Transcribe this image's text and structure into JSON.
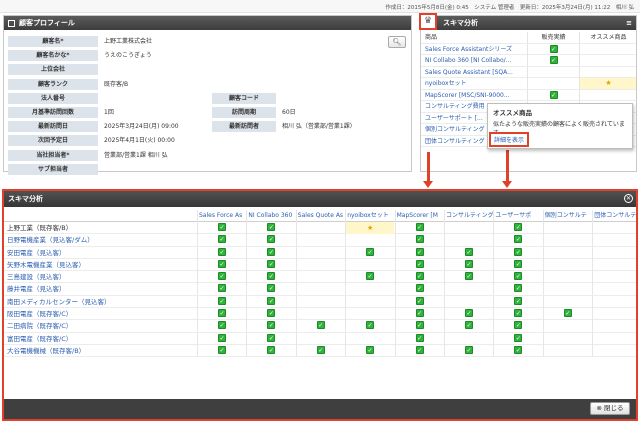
{
  "status_bar": "作成日：2015年5月8日(金) 0:45　システム 管理者　更新日：2025年3月24日(月) 11:22　相川 弘",
  "profile": {
    "title": "顧客プロフィール",
    "search_icon": "search-icon",
    "fields": [
      {
        "label": "顧客名*",
        "value": "上野工業株式会社"
      },
      {
        "label": "顧客名かな*",
        "value": "うえのこうぎょう"
      },
      {
        "label": "上位会社",
        "value": ""
      },
      {
        "label": "顧客ランク",
        "value": "既存客/B"
      },
      {
        "label": "法人番号",
        "value": ""
      },
      {
        "label": "月基準訪問回数",
        "value": "1回"
      },
      {
        "label": "最新訪問日",
        "value": "2025年3月24日(月) 09:00"
      },
      {
        "label": "次回予定日",
        "value": "2025年4月1日(火) 00:00"
      },
      {
        "label": "当社担当者*",
        "value": "営業部/営業1課 相川 弘"
      },
      {
        "label": "サブ担当者",
        "value": ""
      }
    ],
    "right_fields": [
      {
        "label": "顧客コード",
        "value": ""
      },
      {
        "label": "訪問周期",
        "value": "60日"
      },
      {
        "label": "最新訪問者",
        "value": "相川 弘（営業部/営業1課）"
      }
    ]
  },
  "skima_small": {
    "title": "スキマ分析",
    "col_name": "商品",
    "col1": "販売実績",
    "col2": "オススメ商品",
    "rows": [
      {
        "name": "Sales Force Assistantシリーズ",
        "c1": true,
        "c2": false
      },
      {
        "name": "NI Collabo 360 [NI Collabo/...",
        "c1": true,
        "c2": false
      },
      {
        "name": "Sales Quote Assistant [SQA...",
        "c1": false,
        "c2": false
      },
      {
        "name": "nyoiboxセット",
        "c1": false,
        "c2": "star"
      },
      {
        "name": "MapScorer [MSC/SNI-9000...",
        "c1": true,
        "c2": false
      },
      {
        "name": "コンサルティング費用",
        "c1": false,
        "c2": false
      },
      {
        "name": "ユーザーサポート [...",
        "c1": false,
        "c2": false
      },
      {
        "name": "個別コンサルティング",
        "c1": false,
        "c2": false
      },
      {
        "name": "団体コンサルティング [SNI-9...",
        "c1": false,
        "c2": false
      }
    ]
  },
  "tooltip": {
    "title": "オススメ商品",
    "desc": "似たような販売実績の顧客によく販売されています。",
    "link": "詳細を表示"
  },
  "big": {
    "title": "スキマ分析",
    "close_label": "閉じる",
    "columns": [
      "Sales Force As",
      "NI Collabo 360",
      "Sales Quote As",
      "nyoiboxセット",
      "MapScorer [M",
      "コンサルティング",
      "ユーザーサポ",
      "個別コンサルテ",
      "団体コンサルテ"
    ],
    "rows": [
      {
        "name": "上野工業（既存客/B）",
        "cells": [
          1,
          1,
          0,
          "star",
          1,
          0,
          1,
          0,
          0
        ]
      },
      {
        "name": "日野電機産業（見込客/ダム）",
        "cells": [
          1,
          1,
          0,
          0,
          1,
          0,
          1,
          0,
          0
        ]
      },
      {
        "name": "安田電産（見込客）",
        "cells": [
          1,
          1,
          0,
          1,
          1,
          1,
          1,
          0,
          0
        ]
      },
      {
        "name": "矢野木電機産業（見込客）",
        "cells": [
          1,
          1,
          0,
          0,
          1,
          1,
          1,
          0,
          0
        ]
      },
      {
        "name": "三島建設（見込客）",
        "cells": [
          1,
          1,
          0,
          1,
          1,
          1,
          1,
          0,
          0
        ]
      },
      {
        "name": "藤井電産（見込客）",
        "cells": [
          1,
          1,
          0,
          0,
          1,
          0,
          1,
          0,
          0
        ]
      },
      {
        "name": "南田メディカルセンター（見込客）",
        "cells": [
          1,
          1,
          0,
          0,
          1,
          0,
          1,
          0,
          0
        ]
      },
      {
        "name": "阪田電産（既存客/C）",
        "cells": [
          1,
          1,
          0,
          0,
          1,
          1,
          1,
          1,
          0
        ]
      },
      {
        "name": "二田病院（既存客/C）",
        "cells": [
          1,
          1,
          1,
          1,
          1,
          1,
          1,
          0,
          0
        ]
      },
      {
        "name": "富田電産（既存客/C）",
        "cells": [
          1,
          1,
          0,
          0,
          1,
          0,
          1,
          0,
          0
        ]
      },
      {
        "name": "大谷電機機械（既存客/B）",
        "cells": [
          1,
          1,
          1,
          1,
          1,
          1,
          1,
          0,
          0
        ]
      }
    ]
  },
  "colors": {
    "accent": "#e0412b",
    "check": "#2fb33b",
    "link": "#2a5db0",
    "highlight": "#fff6c9"
  }
}
